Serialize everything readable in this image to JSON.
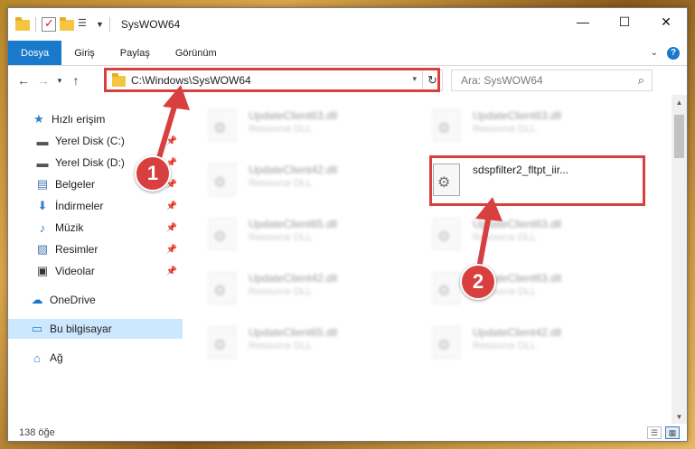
{
  "window": {
    "title": "SysWOW64",
    "buttons": {
      "minimize": "—",
      "maximize": "☐",
      "close": "✕"
    }
  },
  "ribbon": {
    "tabs": [
      "Dosya",
      "Giriş",
      "Paylaş",
      "Görünüm"
    ],
    "active_tab": "Dosya",
    "accent": "#1979ca",
    "help": "?"
  },
  "nav": {
    "address": "C:\\Windows\\SysWOW64",
    "search_placeholder": "Ara: SysWOW64"
  },
  "sidebar": {
    "items": [
      {
        "label": "Hızlı erişim",
        "icon": "star-icon",
        "pinned": false,
        "glyph": "★"
      },
      {
        "label": "Yerel Disk (C:)",
        "icon": "drive-icon",
        "pinned": true,
        "glyph": "▬"
      },
      {
        "label": "Yerel Disk (D:)",
        "icon": "drive-icon",
        "pinned": true,
        "glyph": "▬"
      },
      {
        "label": "Belgeler",
        "icon": "documents-icon",
        "pinned": true,
        "glyph": "▤"
      },
      {
        "label": "İndirmeler",
        "icon": "download-icon",
        "pinned": true,
        "glyph": "⬇"
      },
      {
        "label": "Müzik",
        "icon": "music-icon",
        "pinned": true,
        "glyph": "♪"
      },
      {
        "label": "Resimler",
        "icon": "pictures-icon",
        "pinned": true,
        "glyph": "▧"
      },
      {
        "label": "Videolar",
        "icon": "videos-icon",
        "pinned": true,
        "glyph": "▣"
      },
      {
        "label": "OneDrive",
        "icon": "cloud-icon",
        "pinned": false,
        "glyph": "☁"
      },
      {
        "label": "Bu bilgisayar",
        "icon": "computer-icon",
        "pinned": false,
        "glyph": "▭",
        "selected": true
      },
      {
        "label": "Ağ",
        "icon": "network-icon",
        "pinned": false,
        "glyph": "⌂"
      }
    ]
  },
  "files": [
    {
      "name": "UpdateClient63.dll",
      "type": "Resource DLL",
      "blurred": true
    },
    {
      "name": "UpdateClient63.dll",
      "type": "Resource DLL",
      "blurred": true
    },
    {
      "name": "UpdateClient42.dll",
      "type": "Resource DLL",
      "blurred": true
    },
    {
      "name": "sdspfilter2_fltpt_iir...",
      "type": "",
      "blurred": false,
      "highlighted": true
    },
    {
      "name": "UpdateClient65.dll",
      "type": "Resource DLL",
      "blurred": true
    },
    {
      "name": "UpdateClient63.dll",
      "type": "Resource DLL",
      "blurred": true
    },
    {
      "name": "UpdateClient42.dll",
      "type": "Resource DLL",
      "blurred": true
    },
    {
      "name": "UpdateClient63.dll",
      "type": "Resource DLL",
      "blurred": true
    },
    {
      "name": "UpdateClient65.dll",
      "type": "Resource DLL",
      "blurred": true
    },
    {
      "name": "UpdateClient42.dll",
      "type": "Resource DLL",
      "blurred": true
    }
  ],
  "status": {
    "count": "138 öğe"
  },
  "annotations": {
    "marker1": "1",
    "marker2": "2",
    "color": "#d84040"
  }
}
